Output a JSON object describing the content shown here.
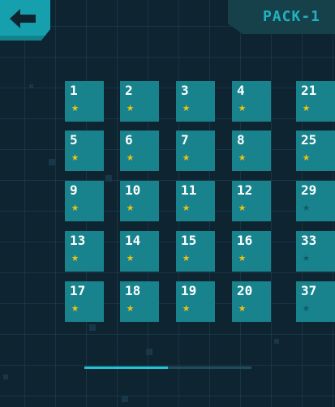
{
  "header": {
    "back_icon": "arrow-left-icon",
    "pack_title": "PACK-1"
  },
  "colors": {
    "background": "#0f2431",
    "tile": "#18838d",
    "star_on": "#f1c40f",
    "star_off": "#115b64",
    "accent": "#16a0ad"
  },
  "levels": [
    {
      "num": "1",
      "star": true
    },
    {
      "num": "2",
      "star": true
    },
    {
      "num": "3",
      "star": true
    },
    {
      "num": "4",
      "star": true
    },
    {
      "num": "21",
      "star": true
    },
    {
      "num": "5",
      "star": true
    },
    {
      "num": "6",
      "star": true
    },
    {
      "num": "7",
      "star": true
    },
    {
      "num": "8",
      "star": true
    },
    {
      "num": "25",
      "star": true
    },
    {
      "num": "9",
      "star": true
    },
    {
      "num": "10",
      "star": true
    },
    {
      "num": "11",
      "star": true
    },
    {
      "num": "12",
      "star": true
    },
    {
      "num": "29",
      "star": false
    },
    {
      "num": "13",
      "star": true
    },
    {
      "num": "14",
      "star": true
    },
    {
      "num": "15",
      "star": true
    },
    {
      "num": "16",
      "star": true
    },
    {
      "num": "33",
      "star": false
    },
    {
      "num": "17",
      "star": true
    },
    {
      "num": "18",
      "star": true
    },
    {
      "num": "19",
      "star": true
    },
    {
      "num": "20",
      "star": true
    },
    {
      "num": "37",
      "star": false
    }
  ],
  "pager": {
    "progress": 0.5
  }
}
